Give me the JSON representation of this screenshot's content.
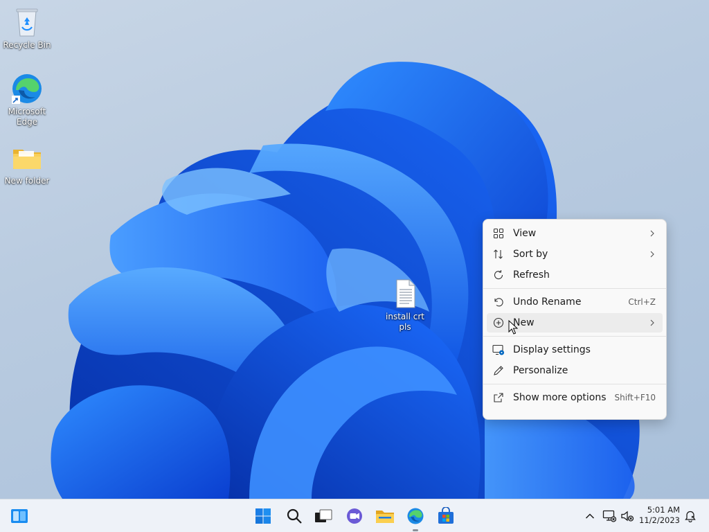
{
  "desktop": {
    "icons": [
      {
        "label": "Recycle Bin"
      },
      {
        "label": "Microsoft Edge"
      },
      {
        "label": "New folder"
      },
      {
        "label": "install crt pls"
      }
    ]
  },
  "context_menu": {
    "items": [
      {
        "label": "View",
        "icon": "grid-view-icon",
        "has_submenu": true
      },
      {
        "label": "Sort by",
        "icon": "sort-arrows-icon",
        "has_submenu": true
      },
      {
        "label": "Refresh",
        "icon": "refresh-icon"
      },
      {
        "label": "Undo Rename",
        "icon": "undo-icon",
        "shortcut": "Ctrl+Z"
      },
      {
        "label": "New",
        "icon": "plus-circle-icon",
        "has_submenu": true,
        "hovered": true
      },
      {
        "label": "Display settings",
        "icon": "display-settings-icon"
      },
      {
        "label": "Personalize",
        "icon": "pen-icon"
      },
      {
        "label": "Show more options",
        "icon": "share-arrow-icon",
        "shortcut": "Shift+F10"
      }
    ]
  },
  "taskbar": {
    "apps": [
      {
        "name": "widgets",
        "icon": "widgets-icon"
      },
      {
        "name": "start",
        "icon": "windows-start-icon"
      },
      {
        "name": "search",
        "icon": "search-icon"
      },
      {
        "name": "task-view",
        "icon": "task-view-icon"
      },
      {
        "name": "chat",
        "icon": "teams-chat-icon"
      },
      {
        "name": "file-explorer",
        "icon": "folder-icon"
      },
      {
        "name": "edge",
        "icon": "edge-icon",
        "running": true
      },
      {
        "name": "store",
        "icon": "store-icon"
      }
    ],
    "tray": {
      "time": "5:01 AM",
      "date": "11/2/2023"
    }
  },
  "colors": {
    "accent": "#0067c0",
    "wallpaper_blue": "#1565e8",
    "menu_bg": "#f9f9f9",
    "taskbar_bg": "#eef2f8"
  }
}
